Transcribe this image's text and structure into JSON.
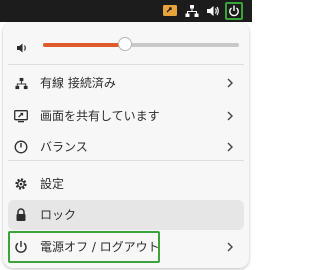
{
  "topbar": {
    "icons": [
      "screen-share-icon",
      "network-wired-icon",
      "volume-icon",
      "power-icon"
    ]
  },
  "volume": {
    "icon": "volume-icon",
    "level": 0.42,
    "accent": "#e05a2b"
  },
  "menu": {
    "items": [
      {
        "label": "有線 接続済み",
        "icon": "network-wired-icon",
        "has_submenu": true
      },
      {
        "label": "画面を共有しています",
        "icon": "screen-share-icon",
        "has_submenu": true
      },
      {
        "label": "バランス",
        "icon": "power-profile-icon",
        "has_submenu": true
      },
      {
        "label": "設定",
        "icon": "gear-icon",
        "has_submenu": false
      },
      {
        "label": "ロック",
        "icon": "lock-icon",
        "has_submenu": false
      },
      {
        "label": "電源オフ / ログアウト",
        "icon": "power-icon",
        "has_submenu": true
      }
    ]
  },
  "colors": {
    "highlight": "#3ca23c",
    "topbar": "#1c1c1c"
  }
}
